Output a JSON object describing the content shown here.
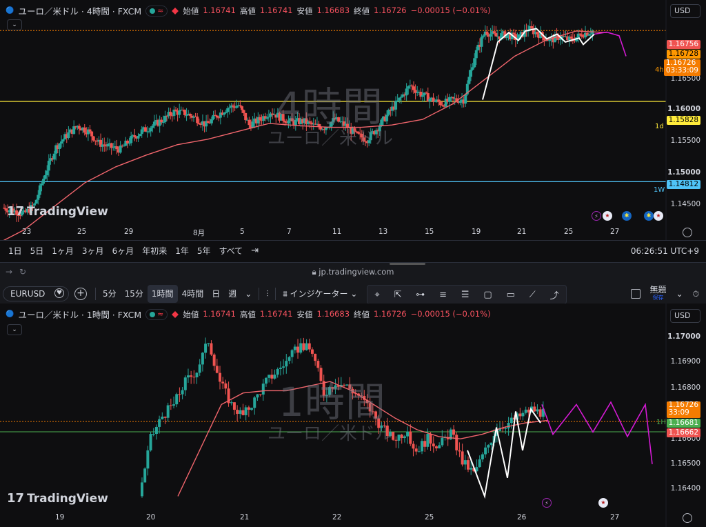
{
  "top": {
    "symbol": "ユーロ／米ドル · 4時間 · FXCM",
    "approx": "≈",
    "open_label": "始値",
    "open": "1.16741",
    "high_label": "高値",
    "high": "1.16741",
    "low_label": "安値",
    "low": "1.16683",
    "close_label": "終値",
    "close": "1.16726",
    "change": "−0.00015 (−0.01%)",
    "currency": "USD",
    "watermark_big": "4時間",
    "watermark_small": "ユーロ／米ドル",
    "logo": "TradingView",
    "price_ticks": [
      "1.16500",
      "1.16000",
      "1.15500",
      "1.15000",
      "1.14500"
    ],
    "tag_high": "1.16756",
    "tag_mid": "1.16728",
    "tag_close": "1.16726",
    "tag_countdown": "03:33:09",
    "tag_1d": "1.15828",
    "tag_1w": "1.14812",
    "lbl_4h": "4h",
    "lbl_1d": "1d",
    "lbl_1w": "1W",
    "x_labels": [
      "23",
      "25",
      "29",
      "8月",
      "5",
      "7",
      "11",
      "13",
      "15",
      "19",
      "21",
      "25",
      "27"
    ],
    "ranges": [
      "1日",
      "5日",
      "1ヶ月",
      "3ヶ月",
      "6ヶ月",
      "年初来",
      "1年",
      "5年",
      "すべて"
    ],
    "clock": "06:26:51 UTC+9"
  },
  "browser": {
    "url": "jp.tradingview.com",
    "symbol": "EURUSD",
    "intervals": [
      "5分",
      "15分",
      "1時間",
      "4時間",
      "日",
      "週"
    ],
    "selected_interval": "1時間",
    "indicators": "インジケーター",
    "layout_name": "無題",
    "layout_status": "保存"
  },
  "bottom": {
    "symbol": "ユーロ／米ドル · 1時間 · FXCM",
    "approx": "≈",
    "open_label": "始値",
    "open": "1.16741",
    "high_label": "高値",
    "high": "1.16741",
    "low_label": "安値",
    "low": "1.16683",
    "close_label": "終値",
    "close": "1.16726",
    "change": "−0.00015 (−0.01%)",
    "currency": "USD",
    "watermark_big": "1時間",
    "watermark_small": "ユーロ／米ドル",
    "logo": "TradingView",
    "price_ticks": [
      "1.17000",
      "1.16900",
      "1.16800",
      "1.16600",
      "1.16500",
      "1.16400"
    ],
    "tag_close": "1.16726",
    "tag_countdown": "33:09",
    "tag_1h": "1.16681",
    "tag_low": "1.16662",
    "lbl_1h": "1H",
    "x_labels": [
      "19",
      "20",
      "21",
      "22",
      "25",
      "26",
      "27"
    ]
  },
  "colors": {
    "up": "#26a69a",
    "down": "#ef5350",
    "ma": "#f0656c",
    "forecast": "#d41ad4",
    "orange_line": "#f57c00",
    "yellow_line": "#ffeb3b",
    "blue_line": "#4fc3f7"
  },
  "chart_data": [
    {
      "type": "candlestick",
      "title": "ユーロ／米ドル · 4時間 · FXCM",
      "x": [
        "23",
        "25",
        "29",
        "8月",
        "5",
        "7",
        "11",
        "13",
        "15",
        "19",
        "21",
        "25",
        "27"
      ],
      "ylim": [
        1.143,
        1.1685
      ],
      "close_path": [
        1.1448,
        1.1445,
        1.144,
        1.1452,
        1.1492,
        1.1525,
        1.154,
        1.1552,
        1.1545,
        1.153,
        1.1525,
        1.1522,
        1.1535,
        1.1545,
        1.1552,
        1.156,
        1.157,
        1.1568,
        1.1562,
        1.1553,
        1.1565,
        1.1575,
        1.1578,
        1.1553,
        1.156,
        1.157,
        1.1562,
        1.1556,
        1.1558,
        1.1552,
        1.155,
        1.156,
        1.1552,
        1.154,
        1.1535,
        1.155,
        1.1568,
        1.1585,
        1.1603,
        1.1592,
        1.1585,
        1.158,
        1.1585,
        1.1585,
        1.164,
        1.1672,
        1.1665,
        1.1668,
        1.1662,
        1.1675,
        1.1668,
        1.166,
        1.1665,
        1.166,
        1.1668,
        1.1672
      ],
      "moving_average": [
        1.14,
        1.142,
        1.145,
        1.148,
        1.15,
        1.1515,
        1.1528,
        1.1535,
        1.1545,
        1.1555,
        1.1552,
        1.155,
        1.155,
        1.1553,
        1.156,
        1.158,
        1.161,
        1.164,
        1.166,
        1.1672,
        1.167
      ],
      "horizontal_levels": {
        "4h": 1.16726,
        "1d": 1.15828,
        "1W": 1.14812
      },
      "last": {
        "open": 1.16741,
        "high": 1.16741,
        "low": 1.16683,
        "close": 1.16726
      }
    },
    {
      "type": "candlestick",
      "title": "ユーロ／米ドル · 1時間 · FXCM",
      "x": [
        "19",
        "20",
        "21",
        "22",
        "25",
        "26",
        "27"
      ],
      "ylim": [
        1.1635,
        1.1715
      ],
      "close_path": [
        1.164,
        1.1665,
        1.1675,
        1.168,
        1.169,
        1.1695,
        1.1708,
        1.169,
        1.168,
        1.1675,
        1.1682,
        1.169,
        1.1695,
        1.17,
        1.1706,
        1.1703,
        1.1685,
        1.169,
        1.1688,
        1.1684,
        1.1678,
        1.167,
        1.1665,
        1.1668,
        1.166,
        1.1665,
        1.1662,
        1.1668,
        1.1655,
        1.165,
        1.166,
        1.167,
        1.1672,
        1.1675,
        1.1678,
        1.1676
      ],
      "moving_average": [
        1.164,
        1.166,
        1.168,
        1.1685,
        1.1686,
        1.1686,
        1.1688,
        1.169,
        1.1686,
        1.168,
        1.1674,
        1.1669,
        1.1666,
        1.1665,
        1.1667,
        1.167,
        1.1672,
        1.1673
      ],
      "horizontal_levels": {
        "close": 1.16726,
        "1H": 1.16681
      },
      "last": {
        "open": 1.16741,
        "high": 1.16741,
        "low": 1.16683,
        "close": 1.16726
      }
    }
  ]
}
